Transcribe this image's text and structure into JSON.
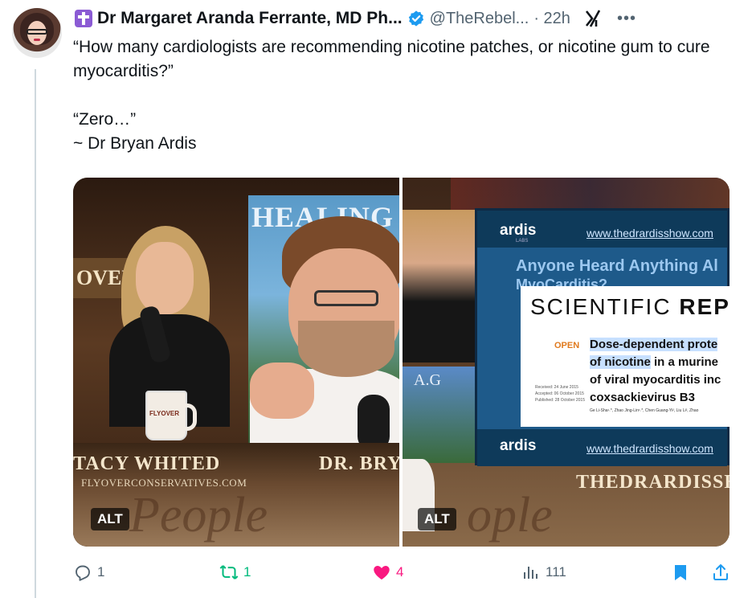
{
  "post": {
    "author": {
      "display_name": "Dr Margaret Aranda Ferrante, MD Ph...",
      "handle": "@TheRebel...",
      "verified": true,
      "badge_icon": "latin-cross-icon",
      "badge_color": "#8b5bd4",
      "verified_color": "#1d9bf0"
    },
    "time": "· 22h",
    "text": {
      "line1": "“How many cardiologists are recommending nicotine patches, or nicotine gum to cure myocarditis?”",
      "line2": "“Zero…”",
      "line3": "~ Dr Bryan Ardis"
    },
    "media": {
      "left": {
        "alt_label": "ALT",
        "screen_text": "HEALING",
        "sign_text": "OVER",
        "lower_third_left": "TACY WHITED",
        "lower_third_left_sub": "FLYOVERCONSERVATIVES.COM",
        "lower_third_right": "DR. BRYA",
        "mug_text": "FLYOVER",
        "script_text": "People"
      },
      "right": {
        "alt_label": "ALT",
        "side_text": "A.G",
        "logo": "ardis",
        "logo_sub": "LABS",
        "url": "www.thedrardisshow.com",
        "question": "Anyone Heard Anything Al",
        "question2": "MyoCarditis?",
        "card_heading_normal": "SCIENTIFIC ",
        "card_heading_bold": "REP",
        "open_label": "OPEN",
        "paper_title_hl1": "Dose-dependent prote",
        "paper_title_hl2": "of nicotine",
        "paper_title_rest2": " in a murine",
        "paper_title_line3": "of viral myocarditis inc",
        "paper_title_line4": "coxsackievirus B3",
        "meta_received": "Received: 24 June 2015",
        "meta_accepted": "Accepted: 06 October 2015",
        "meta_published": "Published: 28 October 2015",
        "authors": "Ge Li-Sha¹˒*, Zhao Jing-Lin¹˒*, Chen Guang-Yi², Liu Li², Zhao",
        "lower_third": "THEDRARDISSH",
        "script_text": "ople"
      }
    },
    "actions": {
      "reply_count": "1",
      "repost_count": "1",
      "like_count": "4",
      "views_count": "111",
      "repost_color": "#00ba7c",
      "like_color": "#f91880",
      "bookmark_color": "#1d9bf0",
      "share_color": "#1d9bf0"
    }
  }
}
